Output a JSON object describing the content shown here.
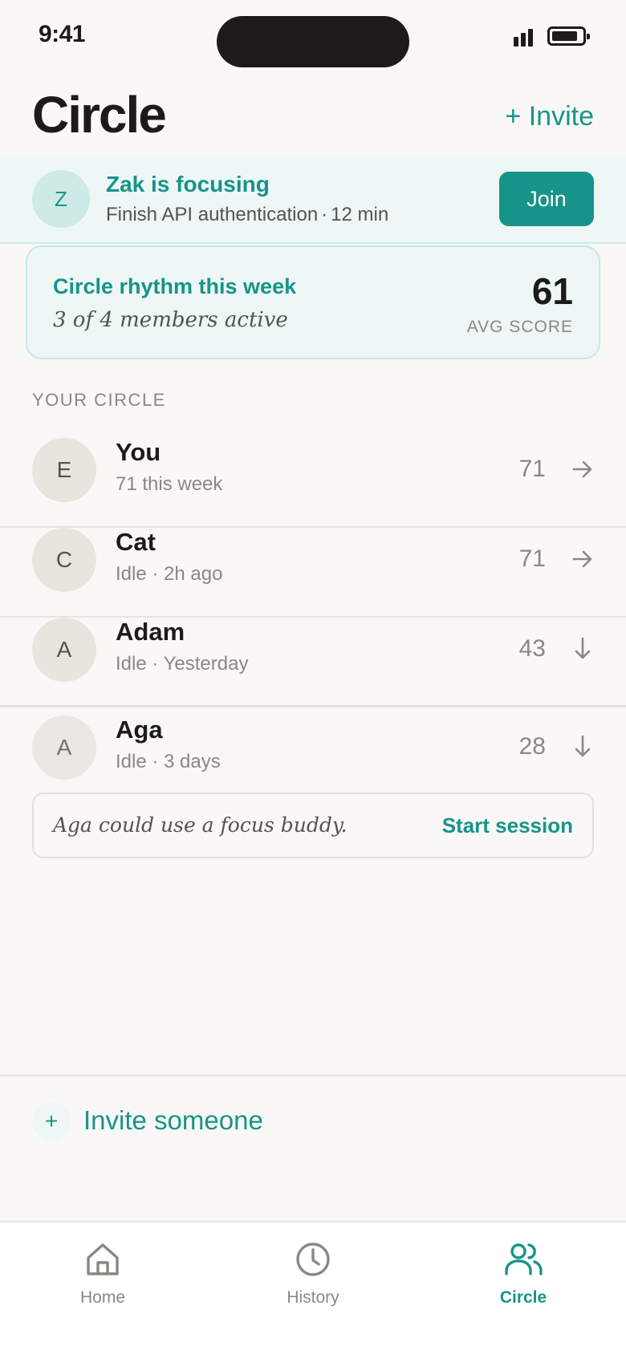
{
  "status_bar": {
    "time": "9:41"
  },
  "header": {
    "title": "Circle",
    "invite_label": "+ Invite"
  },
  "focus_banner": {
    "avatar_initial": "Z",
    "title": "Zak is focusing",
    "task": "Finish API authentication",
    "separator": "·",
    "duration": "12 min",
    "join_label": "Join"
  },
  "rhythm_card": {
    "title": "Circle rhythm this week",
    "subtitle": "3 of 4 members active",
    "score": "61",
    "score_label": "AVG SCORE"
  },
  "circle": {
    "section_label": "YOUR CIRCLE",
    "members": [
      {
        "initial": "E",
        "name": "You",
        "status": "71 this week",
        "score": "71",
        "trend": "right"
      },
      {
        "initial": "C",
        "name": "Cat",
        "status": "Idle · 2h ago",
        "score": "71",
        "trend": "right"
      },
      {
        "initial": "A",
        "name": "Adam",
        "status": "Idle · Yesterday",
        "score": "43",
        "trend": "down"
      },
      {
        "initial": "A",
        "name": "Aga",
        "status": "Idle · 3 days",
        "score": "28",
        "trend": "down"
      }
    ],
    "buddy_prompt": {
      "text": "Aga could use a focus buddy.",
      "action_label": "Start session"
    }
  },
  "invite_row": {
    "icon": "+",
    "label": "Invite someone"
  },
  "tab_bar": {
    "tabs": [
      {
        "label": "Home",
        "icon": "home-icon",
        "active": false
      },
      {
        "label": "History",
        "icon": "clock-icon",
        "active": false
      },
      {
        "label": "Circle",
        "icon": "people-icon",
        "active": true
      }
    ]
  },
  "colors": {
    "accent": "#17948a",
    "background": "#f9f8f6",
    "tint": "#eef7f6",
    "text_primary": "#1c1b19",
    "text_secondary": "#8a8884"
  }
}
